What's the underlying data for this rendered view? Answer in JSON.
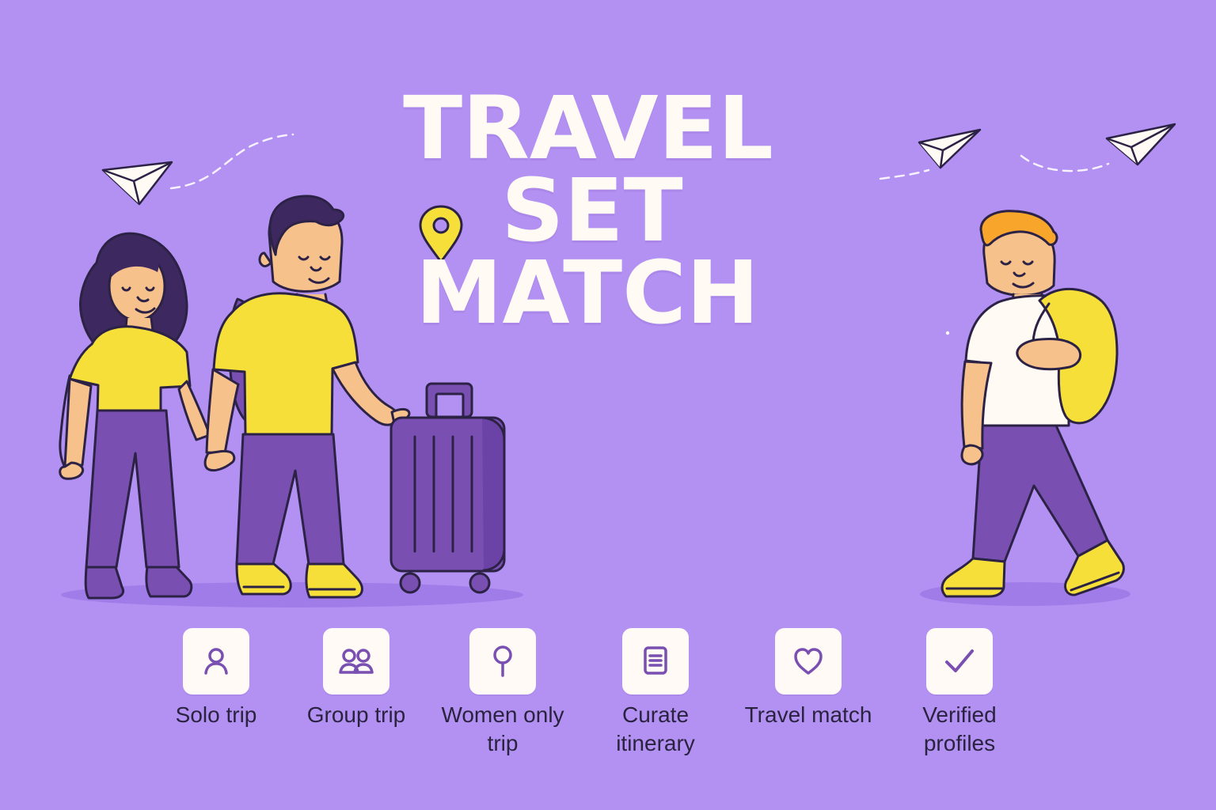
{
  "hero": {
    "title_line_1": "TRAVEL",
    "title_line_2": "SET",
    "title_line_3": "MATCH"
  },
  "theme": {
    "background": "#b391f2",
    "title_color": "#fffaf4",
    "accent_yellow": "#f5df38",
    "accent_purple": "#7a4fb2",
    "text_dark": "#2a2340"
  },
  "features": [
    {
      "label": "Solo trip",
      "icon": "person-icon"
    },
    {
      "label": "Group trip",
      "icon": "group-icon"
    },
    {
      "label": "Women only\ntrip",
      "icon": "location-pin-icon"
    },
    {
      "label": "Curate\nitinerary",
      "icon": "document-icon"
    },
    {
      "label": "Travel match",
      "icon": "heart-icon"
    },
    {
      "label": "Verified\nprofiles",
      "icon": "checkmark-icon"
    }
  ]
}
